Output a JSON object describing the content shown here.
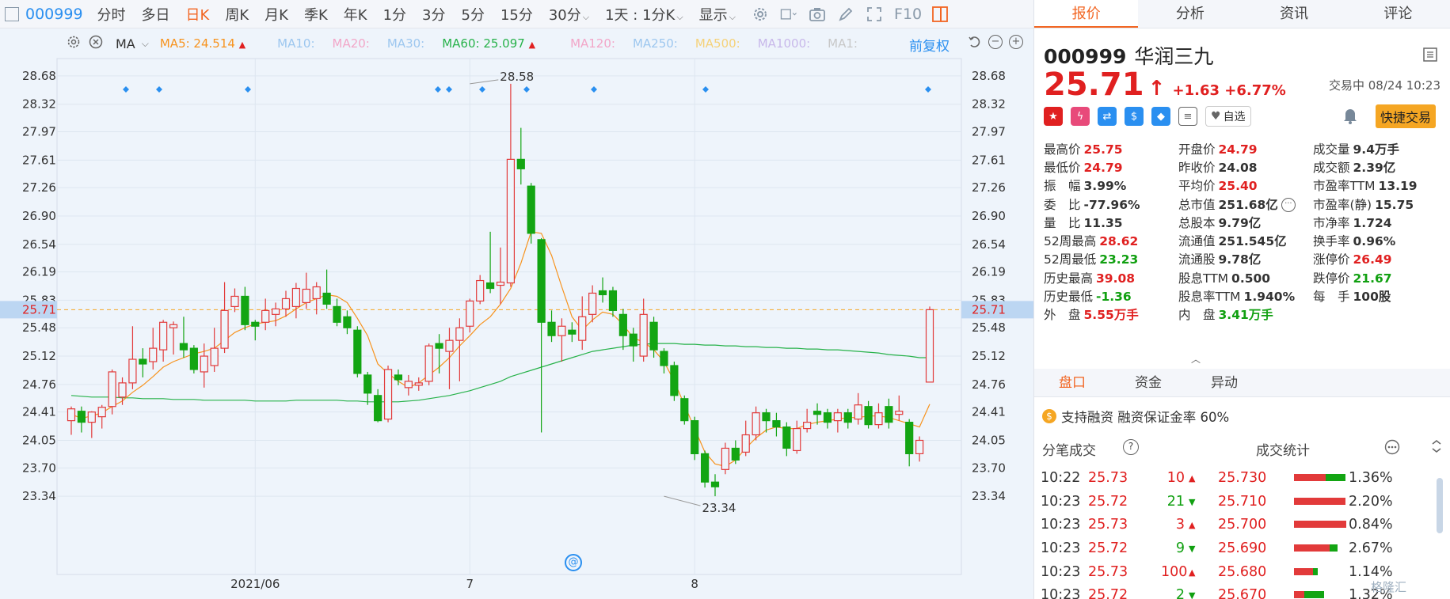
{
  "toolbar": {
    "code": "000999",
    "periods": [
      "分时",
      "多日",
      "日K",
      "周K",
      "月K",
      "季K",
      "年K",
      "1分",
      "3分",
      "5分",
      "15分",
      "30分"
    ],
    "active_period": "日K",
    "interval_select": "1天 : 1分K",
    "display_label": "显示",
    "f10_label": "F10"
  },
  "indicator_bar": {
    "ma_label": "MA",
    "ma5": "MA5: 24.514",
    "ma10": "MA10:",
    "ma20": "MA20:",
    "ma30": "MA30:",
    "ma60": "MA60: 25.097",
    "ma120": "MA120:",
    "ma250": "MA250:",
    "ma500": "MA500:",
    "ma1000": "MA1000:",
    "ma1": "MA1:",
    "adjust_label": "前复权",
    "colors": {
      "ma5": "#f7931e",
      "ma60": "#27b24a",
      "faded": "#9dc7ef",
      "ma20faded": "#f2a6c8",
      "ma500faded": "#f5d27a",
      "ma1000faded": "#c8b8ea"
    }
  },
  "chart_data": {
    "type": "candlestick",
    "title": "",
    "y_ticks": [
      "28.68",
      "28.32",
      "27.97",
      "27.61",
      "27.26",
      "26.90",
      "26.54",
      "26.19",
      "25.83",
      "25.48",
      "25.12",
      "24.76",
      "24.41",
      "24.05",
      "23.70",
      "23.34"
    ],
    "ylim": [
      23.1,
      28.82
    ],
    "x_labels": [
      {
        "label": "2021/06",
        "index": 18
      },
      {
        "label": "7",
        "index": 39
      },
      {
        "label": "8",
        "index": 61
      }
    ],
    "current_price_line": "25.71",
    "high_annotation": {
      "label": "28.58",
      "index": 39
    },
    "low_annotation": {
      "label": "23.34",
      "index": 58
    },
    "up_color": "#e23a3a",
    "down_color": "#13a513",
    "candles": [
      [
        24.3,
        24.45,
        24.48,
        24.12
      ],
      [
        24.42,
        24.28,
        24.48,
        24.15
      ],
      [
        24.28,
        24.41,
        24.42,
        24.08
      ],
      [
        24.35,
        24.47,
        24.5,
        24.2
      ],
      [
        24.48,
        24.92,
        24.95,
        24.38
      ],
      [
        24.6,
        24.78,
        24.85,
        24.5
      ],
      [
        24.78,
        25.08,
        25.5,
        24.7
      ],
      [
        25.08,
        25.02,
        25.22,
        24.85
      ],
      [
        25.05,
        25.22,
        25.48,
        24.95
      ],
      [
        25.2,
        25.55,
        25.58,
        25.05
      ],
      [
        25.48,
        25.52,
        25.56,
        25.14
      ],
      [
        25.28,
        25.2,
        25.62,
        25.1
      ],
      [
        25.22,
        24.95,
        25.26,
        24.9
      ],
      [
        24.92,
        25.12,
        25.28,
        24.72
      ],
      [
        25.0,
        25.22,
        25.48,
        24.92
      ],
      [
        25.22,
        25.7,
        26.06,
        25.16
      ],
      [
        25.75,
        25.88,
        25.98,
        25.68
      ],
      [
        25.88,
        25.52,
        26.0,
        25.45
      ],
      [
        25.55,
        25.5,
        25.58,
        25.32
      ],
      [
        25.55,
        25.7,
        25.85,
        25.45
      ],
      [
        25.65,
        25.72,
        25.8,
        25.5
      ],
      [
        25.72,
        25.85,
        25.95,
        25.62
      ],
      [
        25.75,
        25.98,
        26.05,
        25.6
      ],
      [
        25.8,
        25.97,
        26.18,
        25.72
      ],
      [
        25.85,
        26.0,
        26.06,
        25.65
      ],
      [
        25.92,
        25.78,
        26.22,
        25.72
      ],
      [
        25.75,
        25.55,
        25.85,
        25.5
      ],
      [
        25.62,
        25.48,
        25.7,
        25.4
      ],
      [
        25.45,
        24.9,
        25.5,
        24.85
      ],
      [
        24.88,
        24.65,
        24.92,
        24.5
      ],
      [
        24.62,
        24.3,
        24.7,
        24.28
      ],
      [
        24.32,
        24.95,
        25.0,
        24.28
      ],
      [
        24.88,
        24.82,
        24.95,
        24.75
      ],
      [
        24.72,
        24.8,
        24.88,
        24.62
      ],
      [
        24.75,
        24.78,
        24.85,
        24.68
      ],
      [
        24.8,
        25.25,
        25.28,
        24.75
      ],
      [
        25.28,
        25.22,
        25.4,
        24.9
      ],
      [
        25.18,
        25.32,
        25.48,
        24.7
      ],
      [
        25.32,
        25.48,
        25.6,
        24.8
      ],
      [
        25.5,
        25.82,
        25.85,
        25.42
      ],
      [
        25.82,
        26.08,
        26.15,
        25.78
      ],
      [
        26.05,
        25.98,
        26.7,
        25.92
      ],
      [
        26.02,
        26.06,
        26.5,
        25.78
      ],
      [
        26.05,
        27.62,
        28.58,
        26.0
      ],
      [
        27.62,
        27.5,
        28.02,
        27.3
      ],
      [
        27.28,
        26.68,
        27.32,
        26.55
      ],
      [
        26.6,
        25.55,
        26.62,
        24.15
      ],
      [
        25.55,
        25.38,
        25.7,
        25.3
      ],
      [
        25.38,
        25.5,
        25.6,
        25.05
      ],
      [
        25.45,
        25.4,
        25.55,
        25.3
      ],
      [
        25.32,
        25.62,
        25.88,
        25.2
      ],
      [
        25.65,
        25.92,
        26.02,
        25.55
      ],
      [
        25.95,
        25.9,
        26.12,
        25.8
      ],
      [
        25.95,
        25.7,
        26.0,
        25.62
      ],
      [
        25.65,
        25.38,
        25.72,
        25.2
      ],
      [
        25.4,
        25.25,
        25.48,
        25.05
      ],
      [
        25.12,
        25.65,
        25.85,
        25.05
      ],
      [
        25.55,
        25.2,
        25.62,
        25.1
      ],
      [
        25.18,
        25.0,
        25.22,
        24.9
      ],
      [
        25.0,
        24.62,
        25.05,
        24.55
      ],
      [
        24.58,
        24.3,
        24.62,
        24.25
      ],
      [
        24.3,
        23.88,
        24.35,
        23.8
      ],
      [
        23.88,
        23.52,
        23.92,
        23.45
      ],
      [
        23.52,
        23.46,
        23.62,
        23.34
      ],
      [
        23.68,
        23.95,
        24.02,
        23.62
      ],
      [
        23.95,
        23.8,
        24.05,
        23.75
      ],
      [
        23.9,
        24.12,
        24.3,
        23.85
      ],
      [
        24.12,
        24.4,
        24.48,
        24.05
      ],
      [
        24.4,
        24.3,
        24.45,
        24.15
      ],
      [
        24.3,
        24.22,
        24.4,
        24.1
      ],
      [
        24.22,
        23.95,
        24.28,
        23.85
      ],
      [
        23.92,
        24.2,
        24.3,
        23.88
      ],
      [
        24.2,
        24.28,
        24.45,
        24.15
      ],
      [
        24.42,
        24.38,
        24.52,
        24.25
      ],
      [
        24.4,
        24.28,
        24.45,
        24.2
      ],
      [
        24.3,
        24.4,
        24.45,
        24.15
      ],
      [
        24.4,
        24.28,
        24.45,
        24.2
      ],
      [
        24.32,
        24.5,
        24.65,
        24.25
      ],
      [
        24.48,
        24.25,
        24.55,
        24.2
      ],
      [
        24.25,
        24.4,
        24.52,
        24.2
      ],
      [
        24.48,
        24.28,
        24.58,
        24.2
      ],
      [
        24.38,
        24.42,
        24.62,
        24.3
      ],
      [
        24.28,
        23.88,
        24.32,
        23.72
      ],
      [
        23.88,
        24.05,
        24.1,
        23.78
      ],
      [
        24.79,
        25.71,
        25.75,
        24.79
      ]
    ],
    "ma5": [
      24.38,
      24.33,
      24.36,
      24.4,
      24.48,
      24.55,
      24.66,
      24.75,
      24.86,
      24.98,
      25.05,
      25.1,
      25.15,
      25.18,
      25.22,
      25.32,
      25.42,
      25.48,
      25.53,
      25.55,
      25.57,
      25.63,
      25.72,
      25.8,
      25.85,
      25.9,
      25.88,
      25.8,
      25.6,
      25.38,
      25.02,
      24.9,
      24.8,
      24.72,
      24.78,
      24.88,
      24.98,
      25.1,
      25.25,
      25.38,
      25.52,
      25.62,
      25.78,
      25.98,
      26.3,
      26.7,
      26.68,
      26.4,
      26.0,
      25.62,
      25.45,
      25.58,
      25.68,
      25.65,
      25.52,
      25.35,
      25.3,
      25.2,
      25.05,
      24.8,
      24.5,
      24.2,
      23.9,
      23.75,
      23.72,
      23.8,
      23.95,
      24.08,
      24.18,
      24.22,
      24.2,
      24.2,
      24.25,
      24.28,
      24.3,
      24.32,
      24.34,
      24.34,
      24.36,
      24.36,
      24.34,
      24.3,
      24.26,
      24.22,
      24.51
    ],
    "ma60": [
      24.62,
      24.61,
      24.6,
      24.6,
      24.6,
      24.59,
      24.59,
      24.58,
      24.58,
      24.58,
      24.57,
      24.57,
      24.57,
      24.56,
      24.56,
      24.56,
      24.56,
      24.56,
      24.55,
      24.55,
      24.55,
      24.55,
      24.56,
      24.56,
      24.56,
      24.56,
      24.56,
      24.55,
      24.55,
      24.54,
      24.54,
      24.54,
      24.54,
      24.55,
      24.56,
      24.58,
      24.6,
      24.62,
      24.65,
      24.68,
      24.72,
      24.76,
      24.8,
      24.86,
      24.9,
      24.94,
      24.98,
      25.02,
      25.06,
      25.1,
      25.14,
      25.18,
      25.2,
      25.22,
      25.24,
      25.26,
      25.27,
      25.28,
      25.28,
      25.28,
      25.27,
      25.27,
      25.26,
      25.26,
      25.25,
      25.25,
      25.24,
      25.24,
      25.23,
      25.23,
      25.22,
      25.22,
      25.21,
      25.21,
      25.2,
      25.2,
      25.19,
      25.18,
      25.17,
      25.16,
      25.14,
      25.13,
      25.12,
      25.1,
      25.1
    ]
  },
  "right_panel": {
    "tabs": [
      "报价",
      "分析",
      "资讯",
      "评论"
    ],
    "active_tab": "报价",
    "code": "000999",
    "name": "华润三九",
    "price": "25.71",
    "change": "+1.63",
    "change_pct": "+6.77%",
    "trade_status": "交易中 08/24 10:23",
    "watch_label": "自选",
    "quick_trade": "快捷交易",
    "stats": [
      [
        {
          "label": "最高价",
          "value": "25.75",
          "color": "red"
        },
        {
          "label": "开盘价",
          "value": "24.79",
          "color": "red"
        },
        {
          "label": "成交量",
          "value": "9.4万手",
          "color": "dark"
        }
      ],
      [
        {
          "label": "最低价",
          "value": "24.79",
          "color": "red"
        },
        {
          "label": "昨收价",
          "value": "24.08",
          "color": "dark"
        },
        {
          "label": "成交额",
          "value": "2.39亿",
          "color": "dark"
        }
      ],
      [
        {
          "label": "振　幅",
          "value": "3.99%",
          "color": "dark"
        },
        {
          "label": "平均价",
          "value": "25.40",
          "color": "red"
        },
        {
          "label": "市盈率TTM",
          "value": "13.19",
          "color": "dark"
        }
      ],
      [
        {
          "label": "委　比",
          "value": "-77.96%",
          "color": "dark"
        },
        {
          "label": "总市值",
          "value": "251.68亿",
          "color": "dark"
        },
        {
          "label": "市盈率(静)",
          "value": "15.75",
          "color": "dark"
        }
      ],
      [
        {
          "label": "量　比",
          "value": "11.35",
          "color": "dark"
        },
        {
          "label": "总股本",
          "value": "9.79亿",
          "color": "dark"
        },
        {
          "label": "市净率",
          "value": "1.724",
          "color": "dark"
        }
      ],
      [
        {
          "label": "52周最高",
          "value": "28.62",
          "color": "red"
        },
        {
          "label": "流通值",
          "value": "251.545亿",
          "color": "dark"
        },
        {
          "label": "换手率",
          "value": "0.96%",
          "color": "dark"
        }
      ],
      [
        {
          "label": "52周最低",
          "value": "23.23",
          "color": "green"
        },
        {
          "label": "流通股",
          "value": "9.78亿",
          "color": "dark"
        },
        {
          "label": "涨停价",
          "value": "26.49",
          "color": "red"
        }
      ],
      [
        {
          "label": "历史最高",
          "value": "39.08",
          "color": "red"
        },
        {
          "label": "股息TTM",
          "value": "0.500",
          "color": "dark"
        },
        {
          "label": "跌停价",
          "value": "21.67",
          "color": "green"
        }
      ],
      [
        {
          "label": "历史最低",
          "value": "-1.36",
          "color": "green"
        },
        {
          "label": "股息率TTM",
          "value": "1.940%",
          "color": "dark"
        },
        {
          "label": "每　手",
          "value": "100股",
          "color": "dark"
        }
      ],
      [
        {
          "label": "外　盘",
          "value": "5.55万手",
          "color": "red"
        },
        {
          "label": "内　盘",
          "value": "3.41万手",
          "color": "green"
        },
        {
          "label": "",
          "value": "",
          "color": "dark"
        }
      ]
    ],
    "subtabs": [
      "盘口",
      "资金",
      "异动"
    ],
    "active_subtab": "盘口",
    "margin_text": "支持融资 融资保证金率 60%",
    "trades_title": "分笔成交",
    "stats_title": "成交统计",
    "trades": [
      {
        "time": "10:22",
        "price": "25.73",
        "vol": "10",
        "dir": "up",
        "sp": "25.730",
        "red": 0.55,
        "green": 0.35,
        "pct": "1.36%"
      },
      {
        "time": "10:23",
        "price": "25.72",
        "vol": "21",
        "dir": "down",
        "sp": "25.710",
        "red": 0.9,
        "green": 0.0,
        "pct": "2.20%"
      },
      {
        "time": "10:23",
        "price": "25.73",
        "vol": "3",
        "dir": "up",
        "sp": "25.700",
        "red": 0.92,
        "green": 0.0,
        "pct": "0.84%"
      },
      {
        "time": "10:23",
        "price": "25.72",
        "vol": "9",
        "dir": "down",
        "sp": "25.690",
        "red": 0.62,
        "green": 0.15,
        "pct": "2.67%"
      },
      {
        "time": "10:23",
        "price": "25.73",
        "vol": "100",
        "dir": "up",
        "sp": "25.680",
        "red": 0.33,
        "green": 0.08,
        "pct": "1.14%"
      },
      {
        "time": "10:23",
        "price": "25.72",
        "vol": "2",
        "dir": "down",
        "sp": "25.670",
        "red": 0.18,
        "green": 0.35,
        "pct": "1.32%"
      }
    ],
    "watermark": "格隆汇"
  }
}
